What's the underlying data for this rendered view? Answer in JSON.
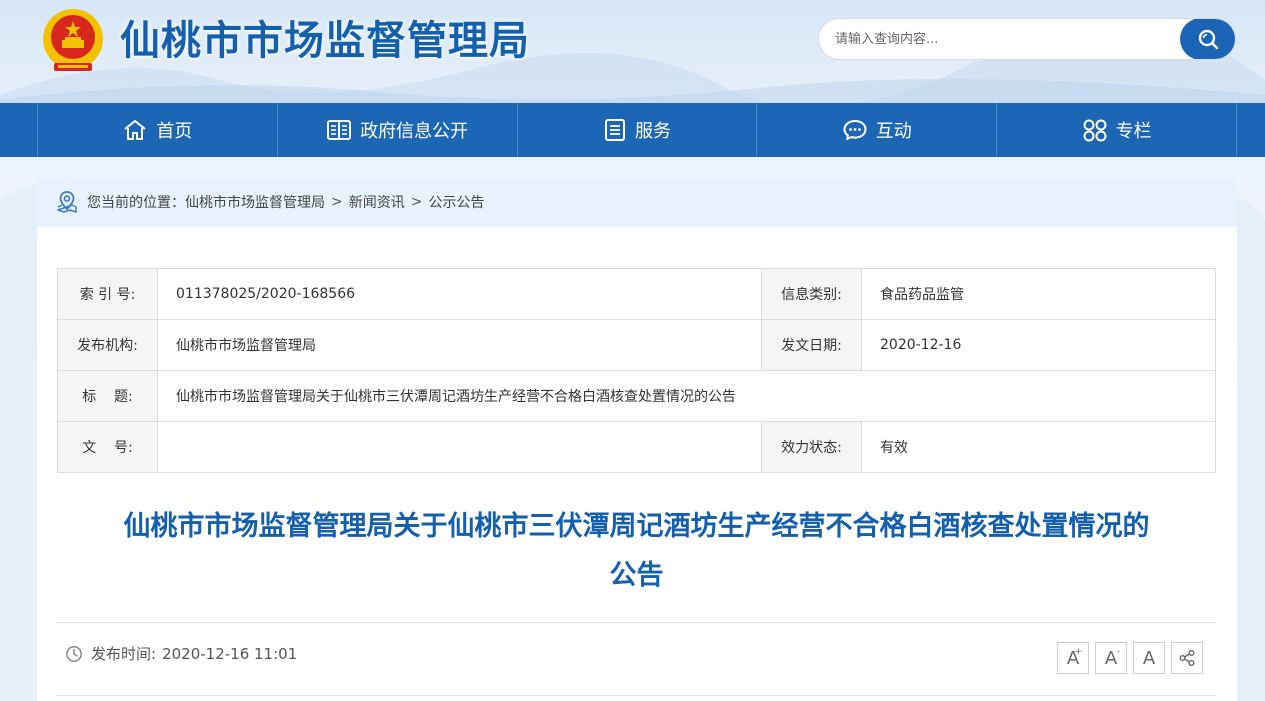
{
  "header": {
    "site_title": "仙桃市市场监督管理局",
    "search_placeholder": "请输入查询内容..."
  },
  "nav": {
    "items": [
      {
        "label": "首页",
        "icon": "home-icon"
      },
      {
        "label": "政府信息公开",
        "icon": "book-icon"
      },
      {
        "label": "服务",
        "icon": "list-icon"
      },
      {
        "label": "互动",
        "icon": "chat-icon"
      },
      {
        "label": "专栏",
        "icon": "grid-icon"
      }
    ]
  },
  "breadcrumb": {
    "prefix": "您当前的位置：",
    "items": [
      "仙桃市市场监督管理局",
      "新闻资讯",
      "公示公告"
    ],
    "separator": ">"
  },
  "info_table": {
    "index_label": "索 引 号:",
    "index_value": "011378025/2020-168566",
    "category_label": "信息类别:",
    "category_value": "食品药品监管",
    "publisher_label": "发布机构:",
    "publisher_value": "仙桃市市场监督管理局",
    "date_label": "发文日期:",
    "date_value": "2020-12-16",
    "title_label": "标    题:",
    "title_value": "仙桃市市场监督管理局关于仙桃市三伏潭周记酒坊生产经营不合格白酒核查处置情况的公告",
    "docno_label": "文    号:",
    "docno_value": "",
    "status_label": "效力状态:",
    "status_value": "有效"
  },
  "article": {
    "title_line1": "仙桃市市场监督管理局关于仙桃市三伏潭周记酒坊生产经营不合格白酒核查处置情况的",
    "title_line2": "公告",
    "publish_label": "发布时间:",
    "publish_time": "2020-12-16 11:01"
  },
  "tools": {
    "font_larger": "A",
    "font_larger_mark": "+",
    "font_smaller": "A",
    "font_smaller_mark": "-",
    "font_reset": "A"
  },
  "colors": {
    "brand_blue": "#1d66b6",
    "title_blue": "#1460ae",
    "emblem_red": "#d7261c",
    "emblem_gold": "#f2c200"
  }
}
